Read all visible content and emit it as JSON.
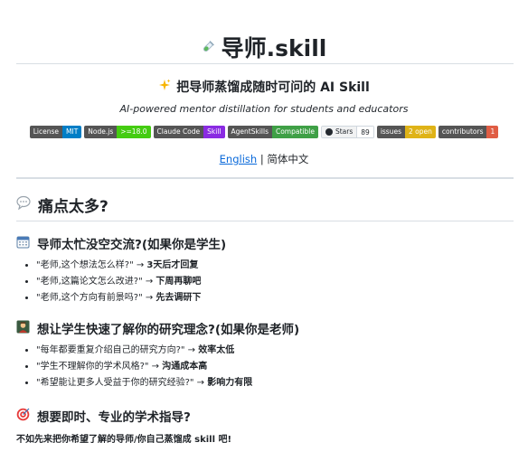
{
  "header": {
    "title_icon": "test-tube-icon",
    "title": "导师.skill",
    "subtitle_icon": "sparkles-icon",
    "subtitle": "把导师蒸馏成随时可问的 AI Skill",
    "tagline": "AI-powered mentor distillation for students and educators"
  },
  "badges": [
    {
      "label": "License",
      "value": "MIT",
      "color": "#007ec6"
    },
    {
      "label": "Node.js",
      "value": ">=18.0",
      "color": "#4c1"
    },
    {
      "label": "Claude Code",
      "value": "Skill",
      "color": "#8a2be2"
    },
    {
      "label": "AgentSkills",
      "value": "Compatible",
      "color": "#3fa046"
    },
    {
      "label": "Stars",
      "value": "89",
      "color": "#ffffff"
    },
    {
      "label": "issues",
      "value": "2 open",
      "color": "#dfb317"
    },
    {
      "label": "contributors",
      "value": "1",
      "color": "#e05d44"
    }
  ],
  "language": {
    "english": "English",
    "separator": "|",
    "chinese": "简体中文"
  },
  "section": {
    "icon": "speech-bubble-icon",
    "title": "痛点太多?"
  },
  "students": {
    "icon": "calendar-icon",
    "heading": "导师太忙没空交流?(如果你是学生)",
    "items": [
      {
        "quote": "\"老师,这个想法怎么样?\" → ",
        "answer": "3天后才回复"
      },
      {
        "quote": "\"老师,这篇论文怎么改进?\" → ",
        "answer": "下周再聊吧"
      },
      {
        "quote": "\"老师,这个方向有前景吗?\" → ",
        "answer": "先去调研下"
      }
    ]
  },
  "teachers": {
    "icon": "teacher-icon",
    "heading": "想让学生快速了解你的研究理念?(如果你是老师)",
    "items": [
      {
        "quote": "\"每年都要重复介绍自己的研究方向?\" → ",
        "answer": "效率太低"
      },
      {
        "quote": "\"学生不理解你的学术风格?\" → ",
        "answer": "沟通成本高"
      },
      {
        "quote": "\"希望能让更多人受益于你的研究经验?\" → ",
        "answer": "影响力有限"
      }
    ]
  },
  "guidance": {
    "icon": "target-icon",
    "heading": "想要即时、专业的学术指导?"
  },
  "closing": "不如先来把你希望了解的导师/你自己蒸馏成 skill 吧!"
}
